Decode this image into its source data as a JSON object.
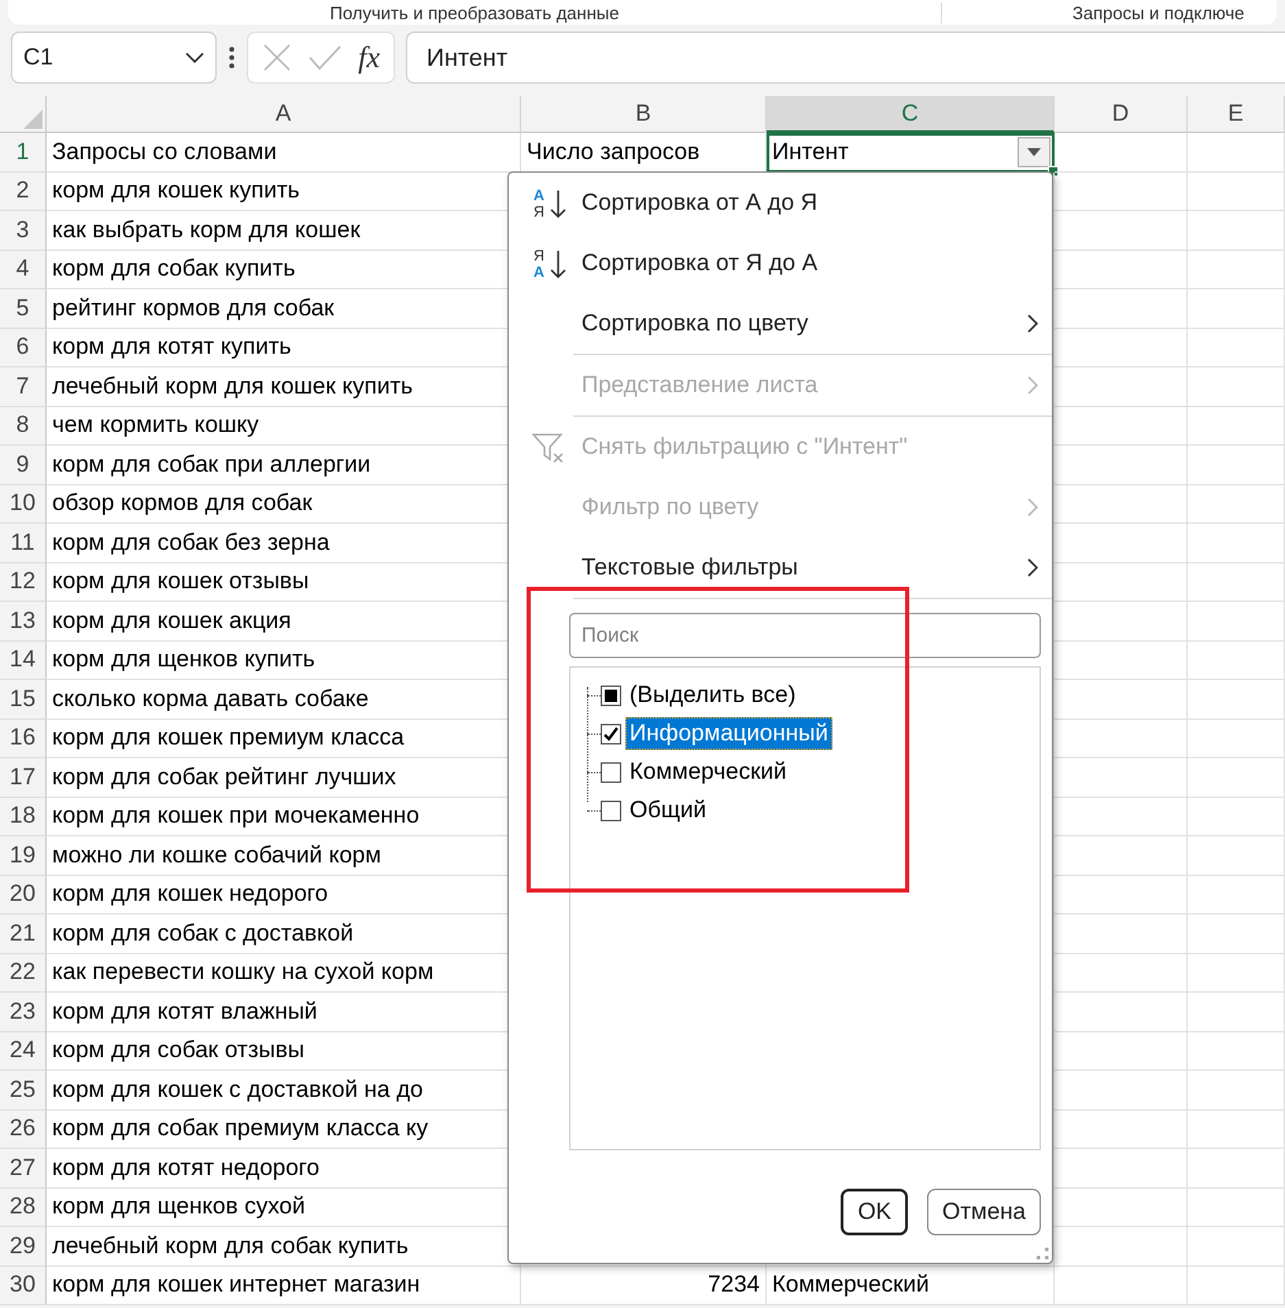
{
  "ribbon": {
    "groups": [
      "Получить и преобразовать данные",
      "Запросы и подключе"
    ]
  },
  "formula_bar": {
    "name_box": "C1",
    "function_button": "fx",
    "value": "Интент"
  },
  "columns": [
    {
      "label": "A",
      "selected": false
    },
    {
      "label": "B",
      "selected": false
    },
    {
      "label": "C",
      "selected": true
    },
    {
      "label": "D",
      "selected": false
    },
    {
      "label": "E",
      "selected": false
    }
  ],
  "rows": [
    {
      "number": "1",
      "cells": [
        "Запросы со словами",
        "Число запросов",
        "Интент"
      ]
    },
    {
      "number": "2",
      "cells": [
        "корм для кошек купить"
      ]
    },
    {
      "number": "3",
      "cells": [
        "как выбрать корм для кошек"
      ]
    },
    {
      "number": "4",
      "cells": [
        "корм для собак купить"
      ]
    },
    {
      "number": "5",
      "cells": [
        "рейтинг кормов для собак"
      ]
    },
    {
      "number": "6",
      "cells": [
        "корм для котят купить"
      ]
    },
    {
      "number": "7",
      "cells": [
        "лечебный корм для кошек купить"
      ]
    },
    {
      "number": "8",
      "cells": [
        "чем кормить кошку"
      ]
    },
    {
      "number": "9",
      "cells": [
        "корм для собак при аллергии"
      ]
    },
    {
      "number": "10",
      "cells": [
        "обзор кормов для собак"
      ]
    },
    {
      "number": "11",
      "cells": [
        "корм для собак без зерна"
      ]
    },
    {
      "number": "12",
      "cells": [
        "корм для кошек отзывы"
      ]
    },
    {
      "number": "13",
      "cells": [
        "корм для кошек акция"
      ]
    },
    {
      "number": "14",
      "cells": [
        "корм для щенков купить"
      ]
    },
    {
      "number": "15",
      "cells": [
        "сколько корма давать собаке"
      ]
    },
    {
      "number": "16",
      "cells": [
        "корм для кошек премиум класса"
      ]
    },
    {
      "number": "17",
      "cells": [
        "корм для собак рейтинг лучших"
      ]
    },
    {
      "number": "18",
      "cells": [
        "корм для кошек при мочекаменно"
      ]
    },
    {
      "number": "19",
      "cells": [
        "можно ли кошке собачий корм"
      ]
    },
    {
      "number": "20",
      "cells": [
        "корм для кошек недорого"
      ]
    },
    {
      "number": "21",
      "cells": [
        "корм для собак с доставкой"
      ]
    },
    {
      "number": "22",
      "cells": [
        "как перевести кошку на сухой корм"
      ]
    },
    {
      "number": "23",
      "cells": [
        "корм для котят влажный"
      ]
    },
    {
      "number": "24",
      "cells": [
        "корм для собак отзывы"
      ]
    },
    {
      "number": "25",
      "cells": [
        "корм для кошек с доставкой на до"
      ]
    },
    {
      "number": "26",
      "cells": [
        "корм для собак премиум класса ку"
      ]
    },
    {
      "number": "27",
      "cells": [
        "корм для котят недорого"
      ]
    },
    {
      "number": "28",
      "cells": [
        "корм для щенков сухой"
      ]
    },
    {
      "number": "29",
      "cells": [
        "лечебный корм для собак купить"
      ]
    },
    {
      "number": "30",
      "cells": [
        "корм для кошек интернет магазин",
        "7234",
        "Коммерческий"
      ]
    }
  ],
  "filter_menu": {
    "items": [
      {
        "kind": "sort-asc",
        "icon_letters": [
          "А",
          "Я"
        ],
        "label": "Сортировка от А до Я",
        "disabled": false,
        "submenu": false,
        "separator_after": false
      },
      {
        "kind": "sort-desc",
        "icon_letters": [
          "Я",
          "А"
        ],
        "label": "Сортировка от Я до А",
        "disabled": false,
        "submenu": false,
        "separator_after": false
      },
      {
        "kind": "plain",
        "label": "Сортировка по цвету",
        "disabled": false,
        "submenu": true,
        "separator_after": true
      },
      {
        "kind": "plain",
        "label": "Представление листа",
        "disabled": true,
        "submenu": true,
        "separator_after": true
      },
      {
        "kind": "clear-filter",
        "label": "Снять фильтрацию с \"Интент\"",
        "disabled": true,
        "submenu": false,
        "separator_after": false
      },
      {
        "kind": "plain",
        "label": "Фильтр по цвету",
        "disabled": true,
        "submenu": true,
        "separator_after": false
      },
      {
        "kind": "plain",
        "label": "Текстовые фильтры",
        "disabled": false,
        "submenu": true,
        "separator_after": true
      }
    ],
    "search": {
      "placeholder": "Поиск"
    },
    "values": [
      {
        "label": "(Выделить все)",
        "checked": false,
        "mixed": true,
        "selected": false
      },
      {
        "label": "Информационный",
        "checked": true,
        "mixed": false,
        "selected": true
      },
      {
        "label": "Коммерческий",
        "checked": false,
        "mixed": false,
        "selected": false
      },
      {
        "label": "Общий",
        "checked": false,
        "mixed": false,
        "selected": false
      }
    ],
    "buttons": [
      {
        "label": "OK",
        "default": true
      },
      {
        "label": "Отмена",
        "default": false
      }
    ]
  }
}
